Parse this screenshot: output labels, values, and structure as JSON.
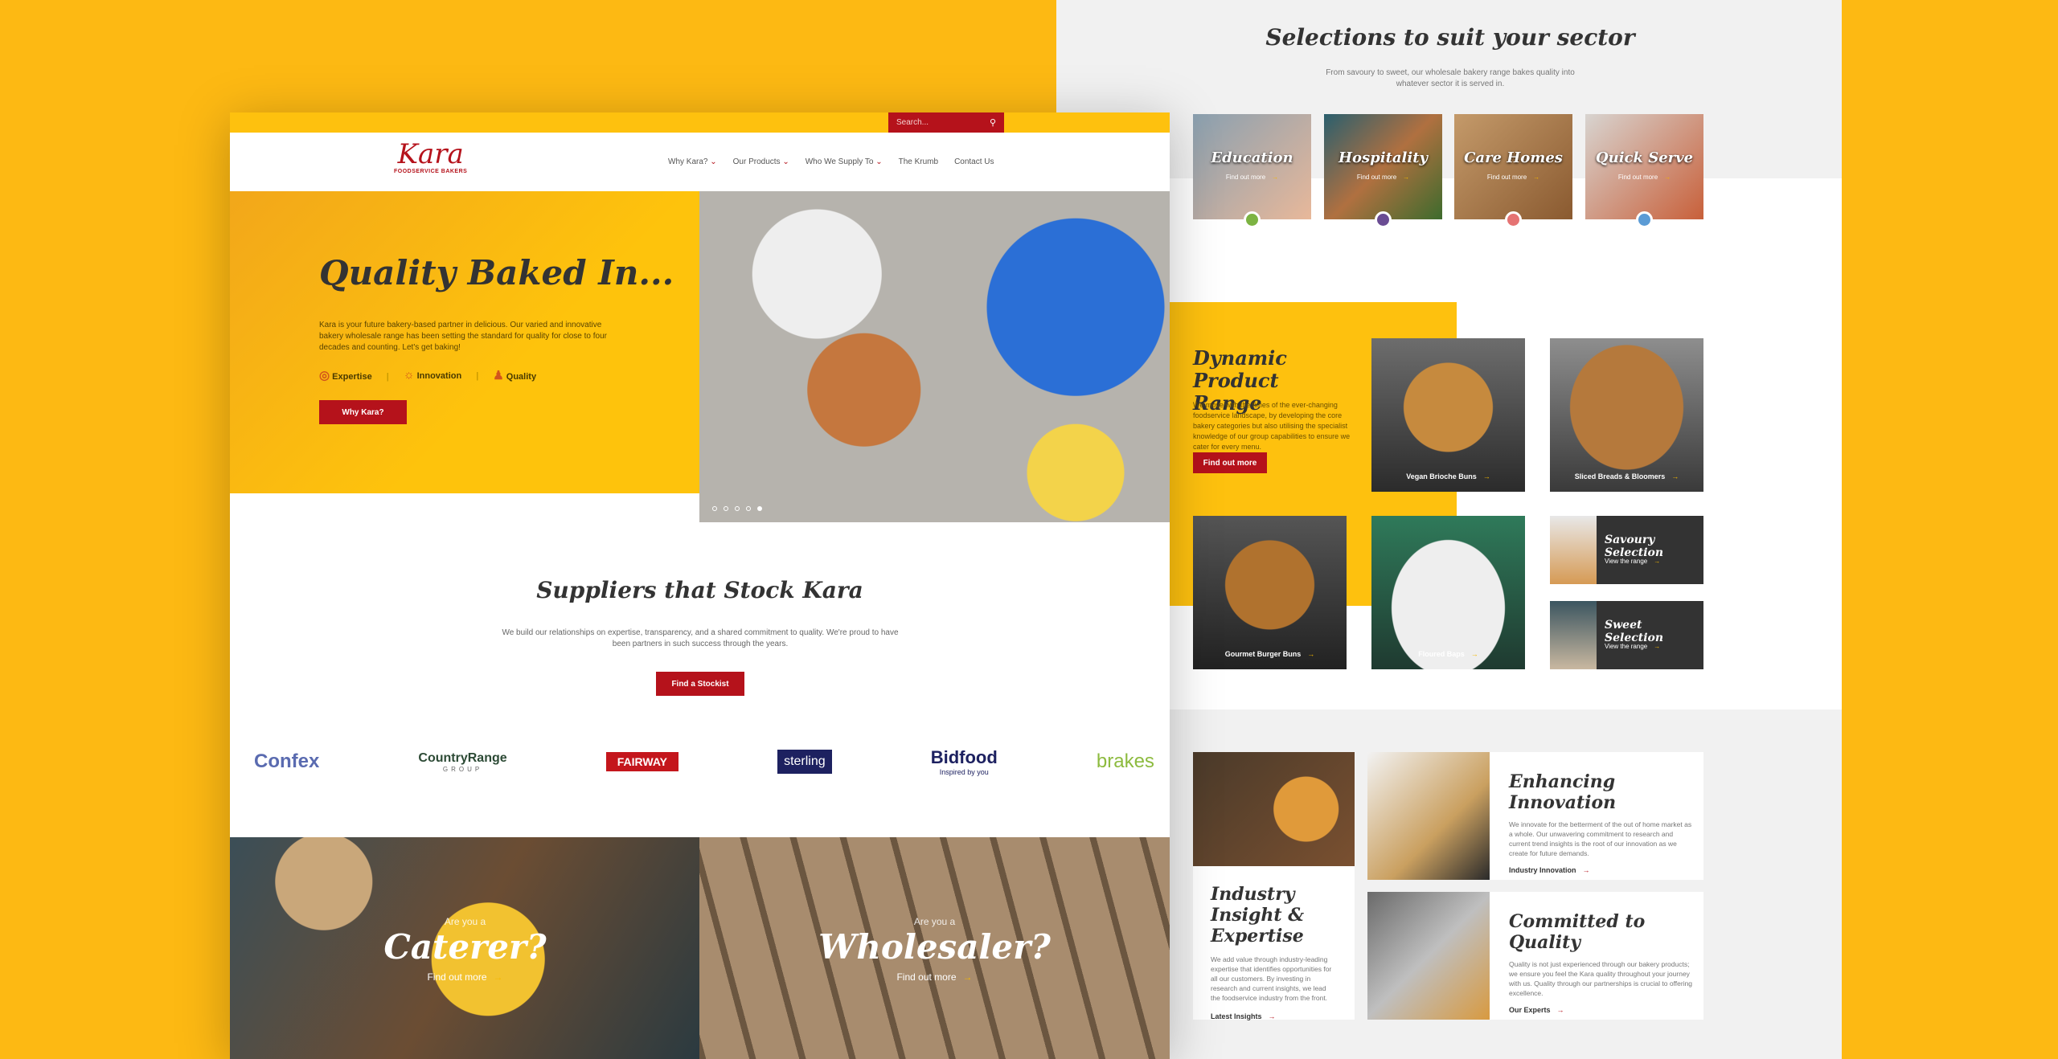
{
  "header": {
    "search_placeholder": "Search...",
    "logo": "Kara",
    "logo_sub": "FOODSERVICE BAKERS",
    "nav": [
      "Why Kara?",
      "Our Products",
      "Who We Supply To",
      "The Krumb",
      "Contact Us"
    ]
  },
  "hero": {
    "title": "Quality Baked In...",
    "text": "Kara is your future bakery-based partner in delicious. Our varied and innovative bakery wholesale range has been setting the standard for quality for close to four decades and counting. Let's get baking!",
    "values": [
      "Expertise",
      "Innovation",
      "Quality"
    ],
    "button": "Why Kara?"
  },
  "suppliers": {
    "title": "Suppliers that Stock Kara",
    "text": "We build our relationships on expertise, transparency, and a shared commitment to quality. We're proud to have been partners in such success through the years.",
    "button": "Find a Stockist",
    "logos": [
      "Confex",
      "CountryRange",
      "FAIRWAY",
      "sterling",
      "Bidfood",
      "brakes"
    ],
    "logo_subs": [
      "GROUP",
      "Inspired by you"
    ]
  },
  "audience": [
    {
      "pre": "Are you a",
      "title": "Caterer?",
      "link": "Find out more"
    },
    {
      "pre": "Are you a",
      "title": "Wholesaler?",
      "link": "Find out more"
    }
  ],
  "sectors": {
    "title": "Selections to suit your sector",
    "text": "From savoury to sweet, our wholesale bakery range bakes quality into whatever sector it is served in.",
    "items": [
      {
        "label": "Education",
        "link": "Find out more",
        "color": "#7cb342"
      },
      {
        "label": "Hospitality",
        "link": "Find out more",
        "color": "#6a4c93"
      },
      {
        "label": "Care Homes",
        "link": "Find out more",
        "color": "#e57373"
      },
      {
        "label": "Quick Serve",
        "link": "Find out more",
        "color": "#5b9bd5"
      }
    ]
  },
  "range": {
    "title": "Dynamic Product Range",
    "text": "We move with the times of the ever-changing foodservice landscape, by developing the core bakery categories but also utilising the specialist knowledge of our group capabilities to ensure we cater for every menu.",
    "button": "Find out more",
    "products": [
      "Vegan Brioche Buns",
      "Sliced Breads & Bloomers",
      "Gourmet Burger Buns",
      "Floured Baps"
    ],
    "selections": [
      {
        "title": "Savoury Selection",
        "link": "View the range"
      },
      {
        "title": "Sweet Selection",
        "link": "View the range"
      }
    ]
  },
  "insight": {
    "title": "Industry Insight & Expertise",
    "text": "We add value through industry-leading expertise that identifies opportunities for all our customers. By investing in research and current insights, we lead the foodservice industry from the front.",
    "link": "Latest Insights"
  },
  "innovation": {
    "title": "Enhancing Innovation",
    "text": "We innovate for the betterment of the out of home market as a whole. Our unwavering commitment to research and current trend insights is the root of our innovation as we create for future demands.",
    "link": "Industry Innovation"
  },
  "quality": {
    "title": "Committed to Quality",
    "text": "Quality is not just experienced through our bakery products; we ensure you feel the Kara quality throughout your journey with us. Quality through our partnerships is crucial to offering excellence.",
    "link": "Our Experts"
  },
  "colors": {
    "brand_red": "#b5121b",
    "yellow": "#FDB913",
    "dark": "#333333"
  }
}
